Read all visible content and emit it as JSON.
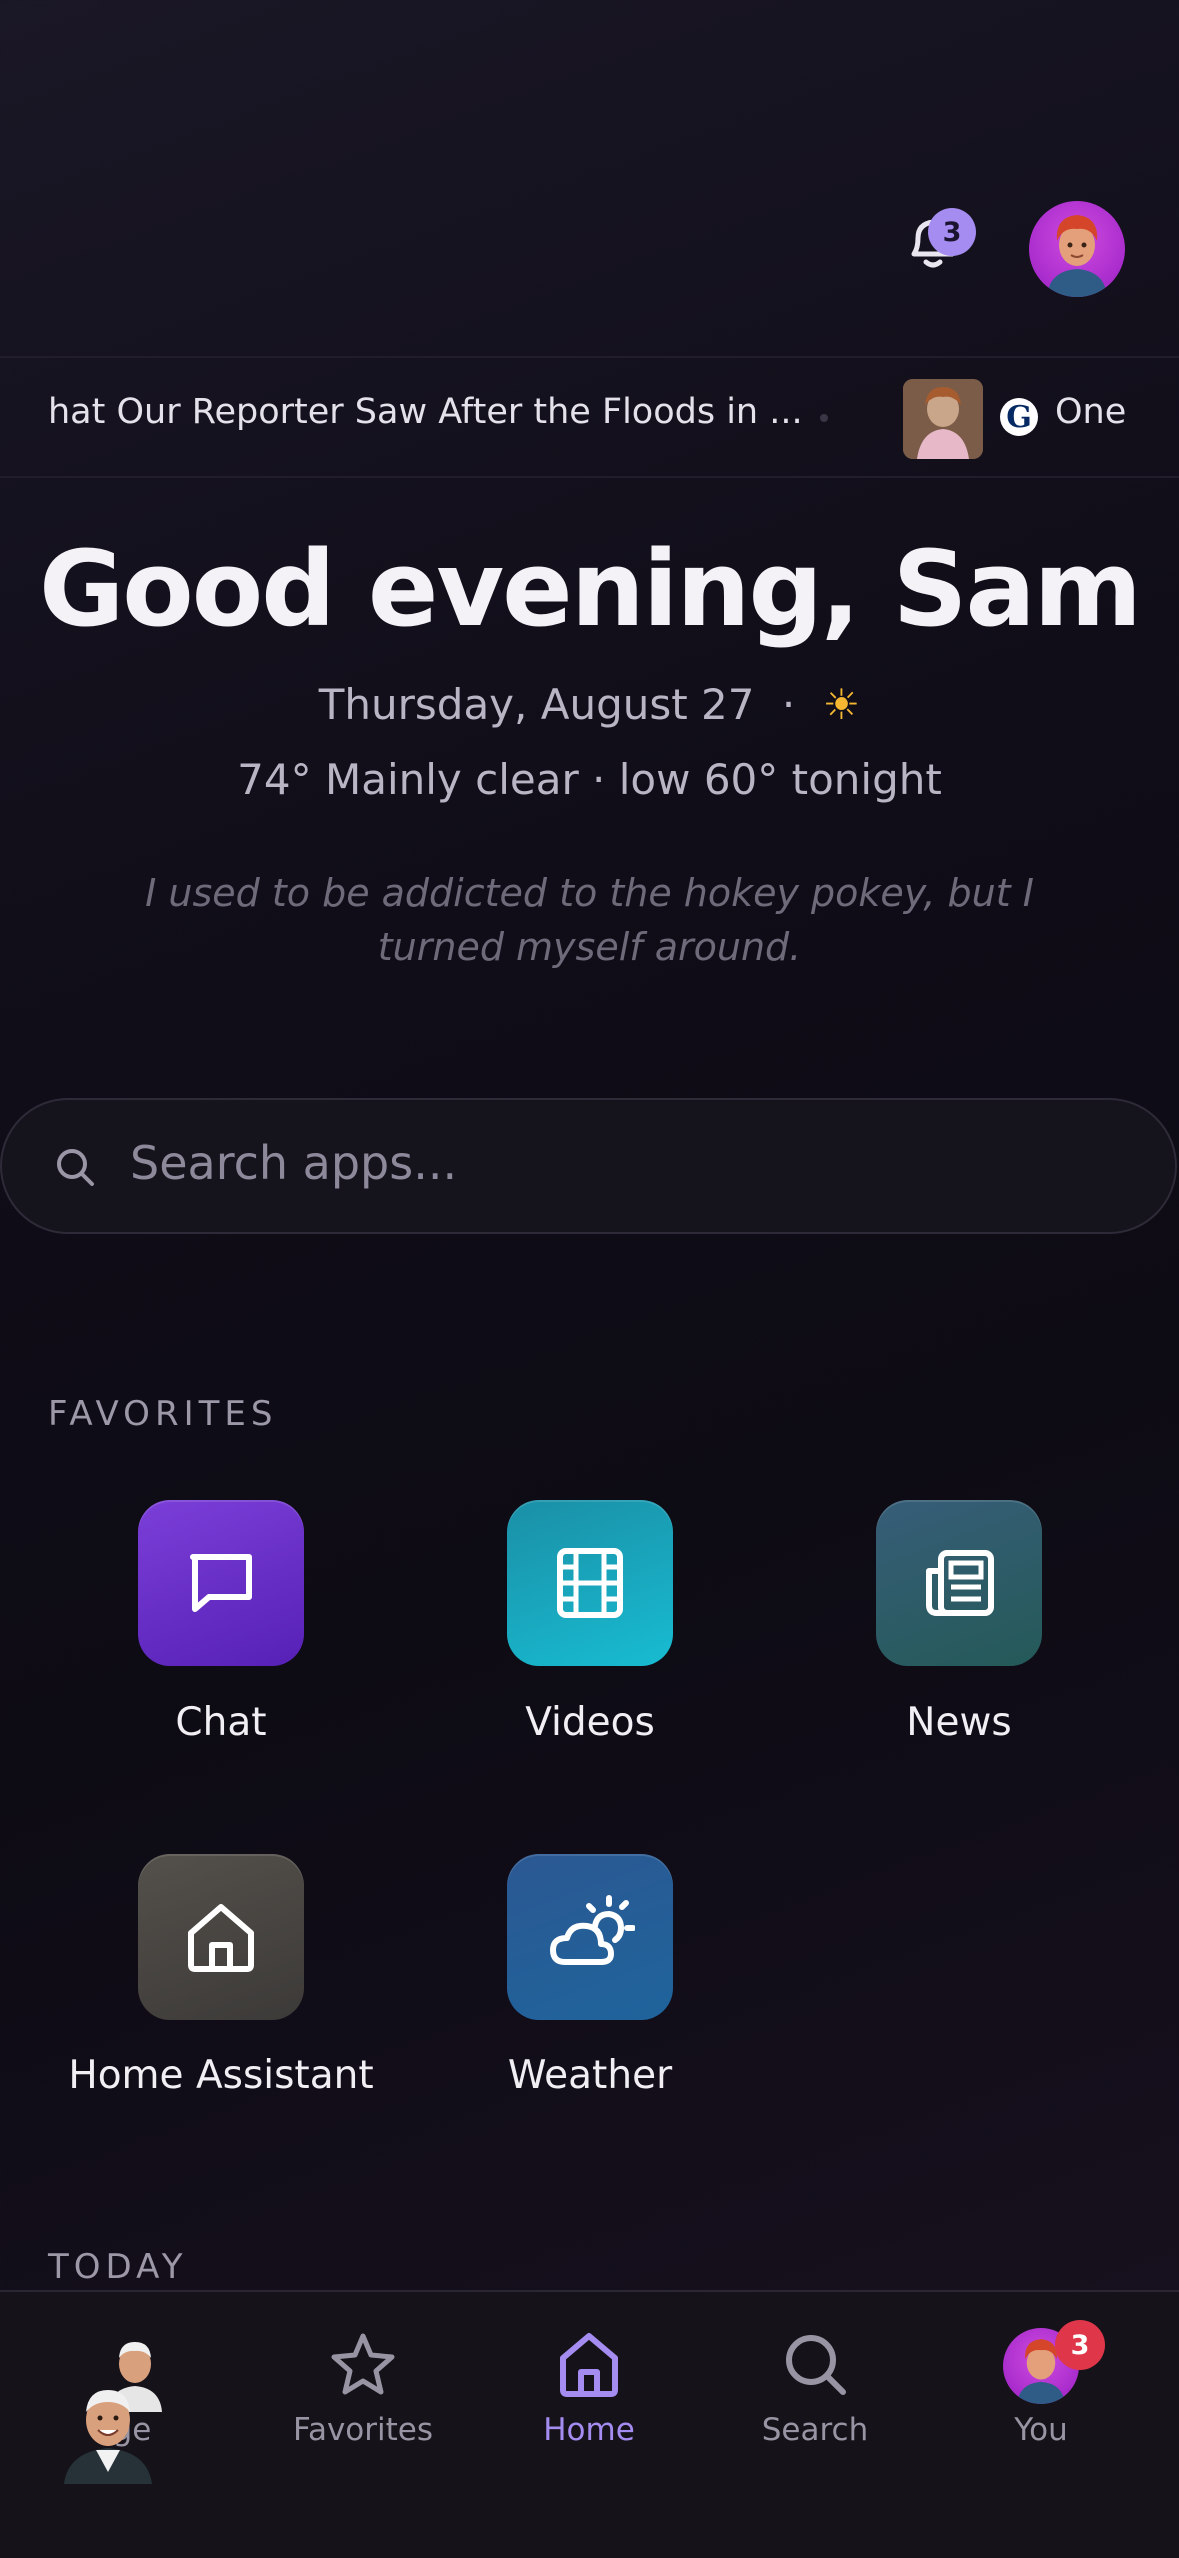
{
  "header": {
    "notifications_count": "3",
    "notifications_icon": "bell-icon",
    "avatar": "profile-avatar"
  },
  "ticker": {
    "headline": "hat Our Reporter Saw After the Floods in ...",
    "source_logo_letter": "G",
    "next_headline": "One"
  },
  "greeting": {
    "title": "Good evening, Sam",
    "date": "Thursday, August 27",
    "separator": "·",
    "sun_glyph": "☀",
    "weather": "74° Mainly clear · low 60° tonight",
    "joke": "I used to be addicted to the hokey pokey, but I turned myself around."
  },
  "search": {
    "placeholder": "Search apps..."
  },
  "favorites": {
    "title": "FAVORITES",
    "apps": [
      {
        "label": "Chat",
        "icon": "chat-bubble-icon",
        "color": "#6b2fc9"
      },
      {
        "label": "Videos",
        "icon": "film-icon",
        "color": "#1aa7bd"
      },
      {
        "label": "News",
        "icon": "newspaper-icon",
        "color": "#2d5a6a"
      },
      {
        "label": "Home Assistant",
        "icon": "house-icon",
        "color": "#4a4744"
      },
      {
        "label": "Weather",
        "icon": "cloud-sun-icon",
        "color": "#235d95"
      }
    ]
  },
  "today": {
    "title": "TODAY"
  },
  "nav": {
    "items": [
      {
        "label": "ge",
        "icon": "avatar-icon"
      },
      {
        "label": "Favorites",
        "icon": "star-icon"
      },
      {
        "label": "Home",
        "icon": "house-icon"
      },
      {
        "label": "Search",
        "icon": "search-icon"
      },
      {
        "label": "You",
        "icon": "profile-avatar"
      }
    ],
    "active": "Home",
    "you_badge": "3",
    "accent_color": "#a48cf0"
  }
}
